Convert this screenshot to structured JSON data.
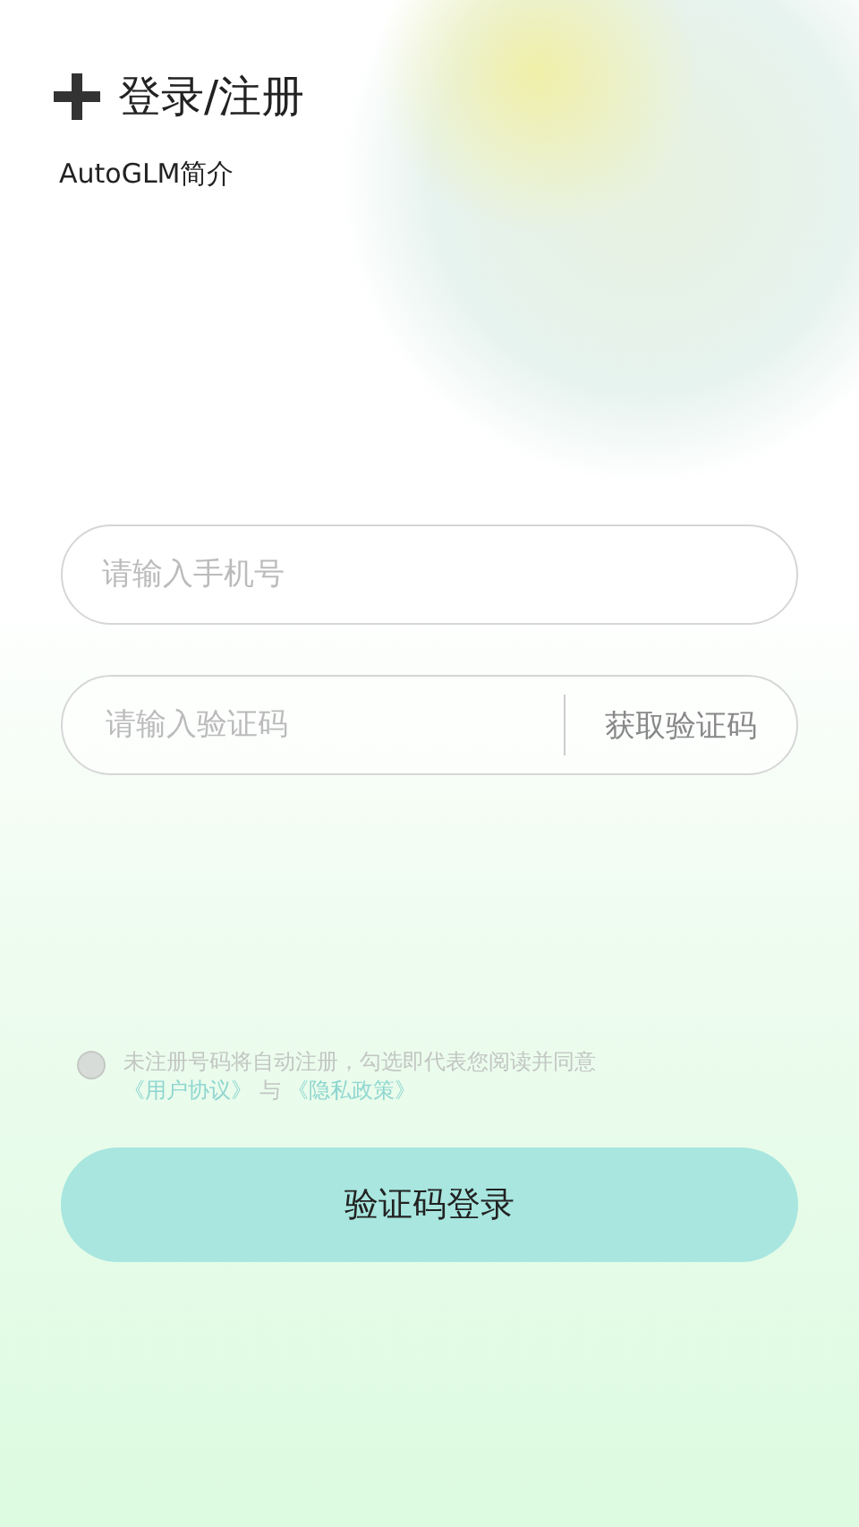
{
  "header": {
    "title": "登录/注册",
    "intro_link": "AutoGLM简介"
  },
  "phone_field": {
    "placeholder": "请输入手机号"
  },
  "code_field": {
    "placeholder": "请输入验证码",
    "action": "获取验证码"
  },
  "agreement": {
    "checked": false,
    "text": "未注册号码将自动注册，勾选即代表您阅读并同意",
    "user_agreement": "《用户协议》",
    "joiner": "与",
    "privacy_policy": "《隐私政策》"
  },
  "login_button": "验证码登录"
}
